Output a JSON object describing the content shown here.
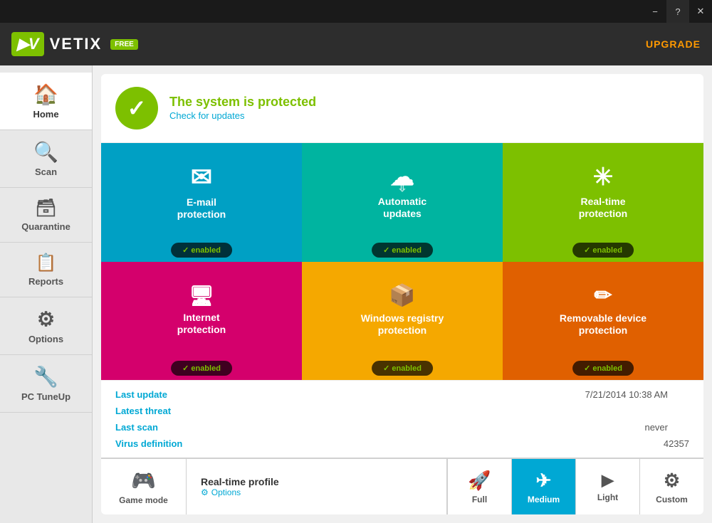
{
  "titlebar": {
    "minimize_label": "−",
    "help_label": "?",
    "close_label": "✕"
  },
  "header": {
    "logo_text": "VETIX",
    "logo_badge": "FREE",
    "upgrade_label": "UPGRADE"
  },
  "sidebar": {
    "items": [
      {
        "id": "home",
        "label": "Home",
        "icon": "🏠",
        "active": true
      },
      {
        "id": "scan",
        "label": "Scan",
        "icon": "🔍"
      },
      {
        "id": "quarantine",
        "label": "Quarantine",
        "icon": "🗄"
      },
      {
        "id": "reports",
        "label": "Reports",
        "icon": "📋"
      },
      {
        "id": "options",
        "label": "Options",
        "icon": "⚙"
      },
      {
        "id": "pctuneup",
        "label": "PC TuneUp",
        "icon": "🔧"
      }
    ]
  },
  "status": {
    "title": "The system is protected",
    "link": "Check for updates",
    "icon": "✓"
  },
  "protection_cards": [
    {
      "id": "email",
      "label": "E-mail\nprotection",
      "status": "enabled",
      "icon": "✉"
    },
    {
      "id": "updates",
      "label": "Automatic\nupdates",
      "status": "enabled",
      "icon": "☁"
    },
    {
      "id": "realtime",
      "label": "Real-time\nprotection",
      "status": "enabled",
      "icon": "⚙"
    },
    {
      "id": "internet",
      "label": "Internet\nprotection",
      "status": "enabled",
      "icon": "🖥"
    },
    {
      "id": "registry",
      "label": "Windows registry\nprotection",
      "status": "enabled",
      "icon": "📦"
    },
    {
      "id": "removable",
      "label": "Removable device\nprotection",
      "status": "enabled",
      "icon": "🔑"
    }
  ],
  "info": {
    "last_update_label": "Last update",
    "last_update_value": "7/21/2014 10:38 AM",
    "latest_threat_label": "Latest threat",
    "latest_threat_value": "",
    "last_scan_label": "Last scan",
    "last_scan_value": "never",
    "virus_def_label": "Virus definition",
    "virus_def_value": "42357"
  },
  "bottom": {
    "game_mode_label": "Game mode",
    "realtime_profile_title": "Real-time profile",
    "realtime_profile_options": "Options",
    "profile_tabs": [
      {
        "id": "full",
        "label": "Full",
        "icon": "🚀"
      },
      {
        "id": "medium",
        "label": "Medium",
        "icon": "✈",
        "active": true
      },
      {
        "id": "light",
        "label": "Light",
        "icon": "▶"
      },
      {
        "id": "custom",
        "label": "Custom",
        "icon": "⚙"
      }
    ]
  }
}
